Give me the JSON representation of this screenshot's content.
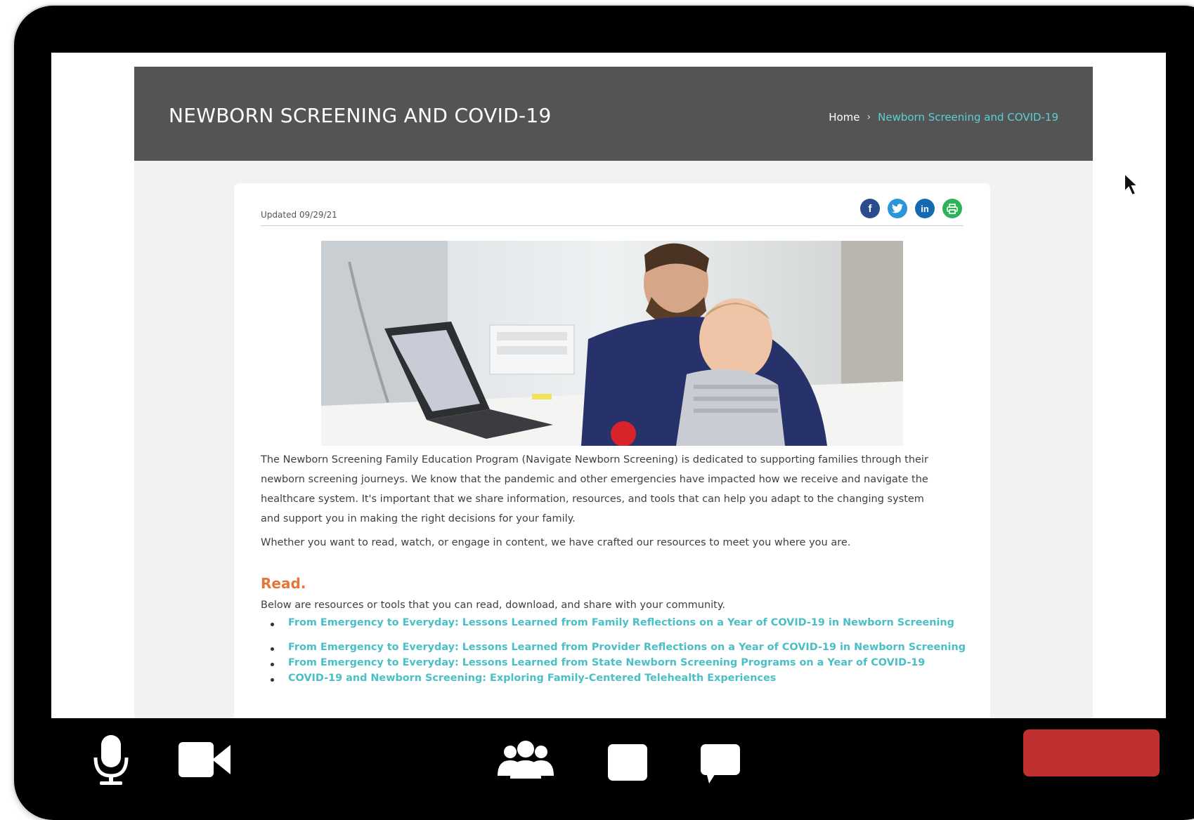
{
  "banner": {
    "title": "NEWBORN SCREENING AND COVID-19",
    "breadcrumb": {
      "home": "Home",
      "separator": "›",
      "current": "Newborn Screening and COVID-19"
    }
  },
  "article": {
    "updated": "Updated 09/29/21",
    "share_icons": [
      "facebook-icon",
      "twitter-icon",
      "linkedin-icon",
      "print-icon"
    ],
    "share_colors": {
      "facebook": "#2b4c8c",
      "twitter": "#2a95d8",
      "linkedin": "#1569b0",
      "print": "#2fb35a"
    },
    "hero_alt": "father-with-baby-at-laptop",
    "intro": "The Newborn Screening Family Education Program (Navigate Newborn Screening) is dedicated to supporting families through their newborn screening journeys. We know that the pandemic and other emergencies have impacted how we receive and navigate the healthcare system. It's important that we share information, resources, and tools that can help you adapt to the changing system and support you in making the right decisions for your family.",
    "intro2": "Whether you want to read, watch, or engage in content, we have crafted our resources to meet you where you are.",
    "read_heading": "Read.",
    "read_desc": "Below are resources or tools that you can read, download, and share with your community.",
    "links": [
      "From Emergency to Everyday: Lessons Learned from Family Reflections on a Year of COVID-19 in Newborn Screening",
      "From Emergency to Everyday: Lessons Learned from Provider Reflections on a Year of COVID-19 in Newborn Screening",
      "From Emergency to Everyday: Lessons Learned from State Newborn Screening Programs on a Year of COVID-19",
      "COVID-19 and Newborn Screening: Exploring Family-Centered Telehealth Experiences"
    ],
    "link_color": "#4bbfc6",
    "accent_color": "#e3773a"
  },
  "call_controls": [
    "microphone-icon",
    "camera-icon",
    "participants-icon",
    "share-screen-icon",
    "chat-icon",
    "leave-button"
  ]
}
